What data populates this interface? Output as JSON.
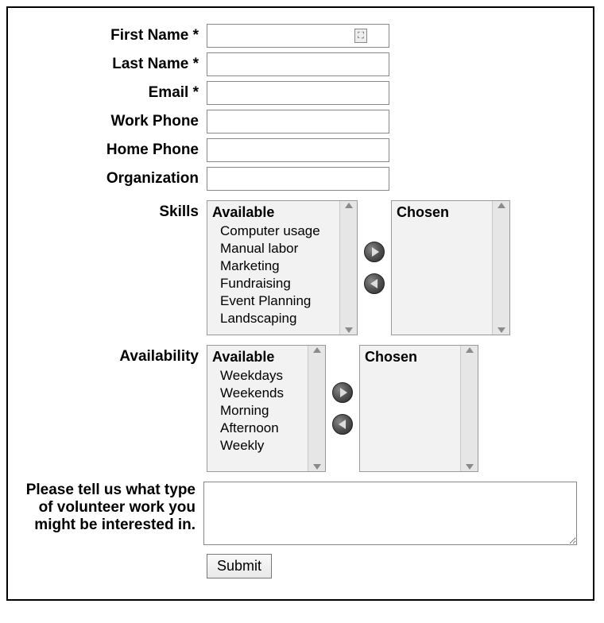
{
  "labels": {
    "first_name": "First Name *",
    "last_name": "Last Name *",
    "email": "Email *",
    "work_phone": "Work Phone",
    "home_phone": "Home Phone",
    "organization": "Organization",
    "skills": "Skills",
    "availability": "Availability",
    "comments": "Please tell us what type of volunteer work you might be interested in."
  },
  "values": {
    "first_name": "",
    "last_name": "",
    "email": "",
    "work_phone": "",
    "home_phone": "",
    "organization": "",
    "comments": ""
  },
  "skills": {
    "available_header": "Available",
    "chosen_header": "Chosen",
    "available": [
      "Computer usage",
      "Manual labor",
      "Marketing",
      "Fundraising",
      "Event Planning",
      "Landscaping"
    ],
    "chosen": []
  },
  "availability": {
    "available_header": "Available",
    "chosen_header": "Chosen",
    "available": [
      "Weekdays",
      "Weekends",
      "Morning",
      "Afternoon",
      "Weekly"
    ],
    "chosen": []
  },
  "buttons": {
    "submit": "Submit"
  },
  "icons": {
    "autofill": "⛶"
  }
}
